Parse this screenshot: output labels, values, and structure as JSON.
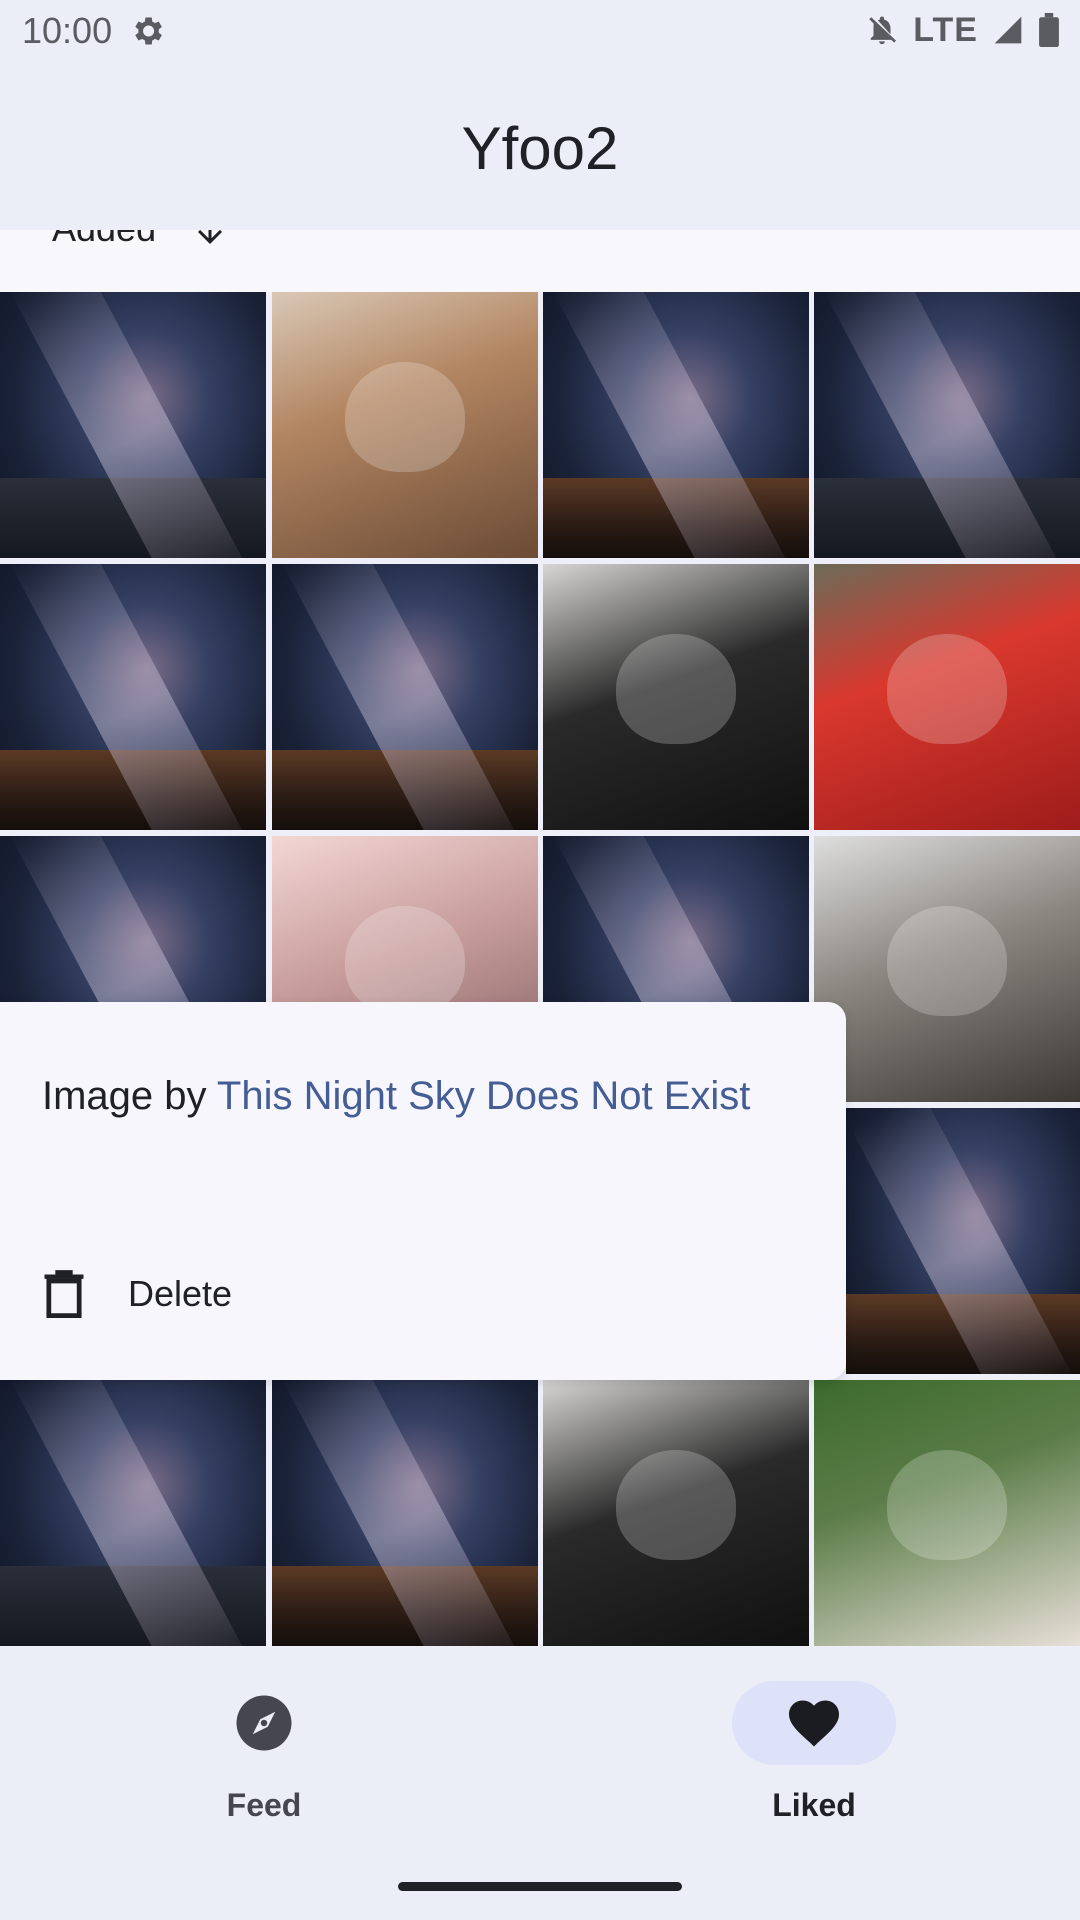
{
  "status_bar": {
    "time": "10:00",
    "network": "LTE",
    "icons": [
      "settings-gear-icon",
      "bell-off-icon",
      "signal-icon",
      "battery-icon"
    ]
  },
  "app_bar": {
    "title": "Yfoo2"
  },
  "sort": {
    "label": "Added",
    "icon": "sort-down-arrow-icon"
  },
  "grid": {
    "tiles": [
      {
        "kind": "sky"
      },
      {
        "kind": "cat",
        "tone": "orange"
      },
      {
        "kind": "sky"
      },
      {
        "kind": "sky"
      },
      {
        "kind": "sky"
      },
      {
        "kind": "sky"
      },
      {
        "kind": "cat",
        "tone": "black"
      },
      {
        "kind": "cat",
        "tone": "red"
      },
      {
        "kind": "sky"
      },
      {
        "kind": "cat",
        "tone": "pink"
      },
      {
        "kind": "sky"
      },
      {
        "kind": "cat",
        "tone": "gray"
      },
      {
        "kind": "sky"
      },
      {
        "kind": "sky"
      },
      {
        "kind": "cat",
        "tone": "black"
      },
      {
        "kind": "cat",
        "tone": "green"
      }
    ]
  },
  "sheet": {
    "credit_prefix": "Image by ",
    "credit_link": "This Night Sky Does Not Exist",
    "delete_label": "Delete",
    "delete_icon": "trash-icon"
  },
  "bottom_nav": {
    "items": [
      {
        "label": "Feed",
        "icon": "compass-icon",
        "selected": false
      },
      {
        "label": "Liked",
        "icon": "heart-icon",
        "selected": true
      }
    ]
  },
  "colors": {
    "link": "#445d95",
    "selected_pill": "#dde2f8",
    "sheet_bg": "#f6f6fc"
  }
}
